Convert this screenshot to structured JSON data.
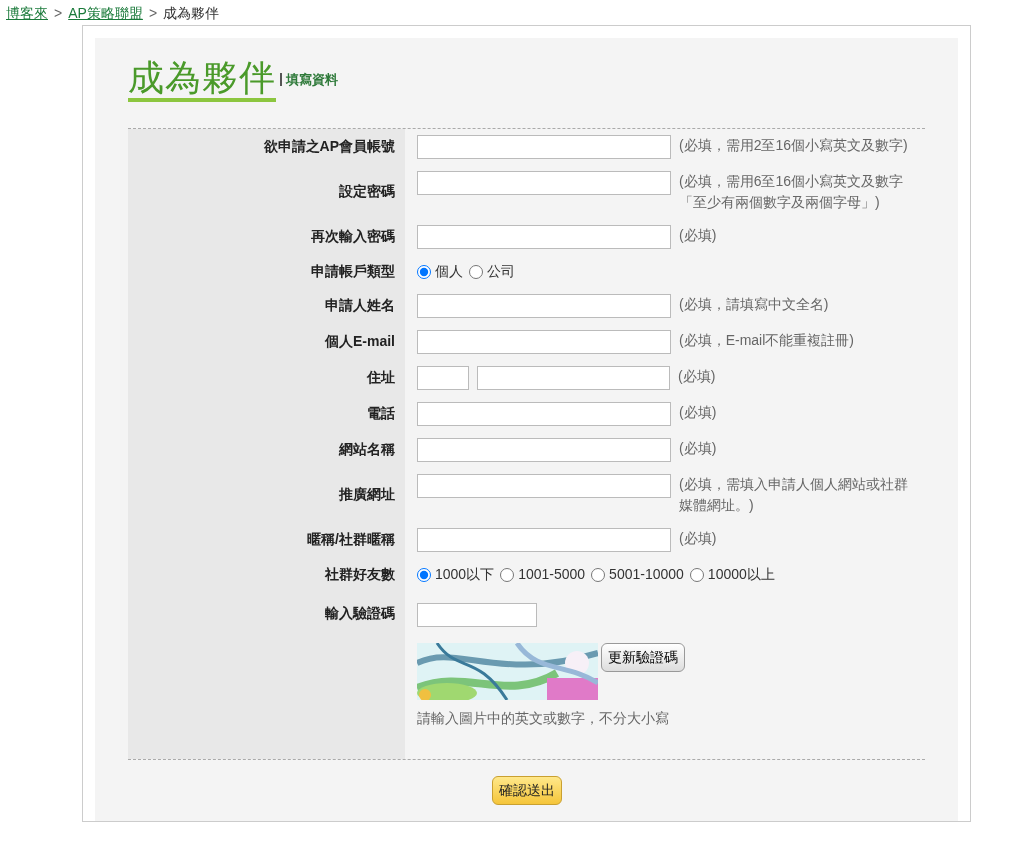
{
  "breadcrumb": [
    {
      "label": "博客來",
      "link": true
    },
    {
      "label": "AP策略聯盟",
      "link": true
    },
    {
      "label": "成為夥伴",
      "link": false
    }
  ],
  "breadcrumb_separator": ">",
  "heading": {
    "title": "成為夥伴",
    "subtitle": "填寫資料"
  },
  "form_rows": [
    {
      "kind": "text",
      "label": "欲申請之AP會員帳號",
      "hint": "(必填，需用2至16個小寫英文及數字)"
    },
    {
      "kind": "text",
      "label": "設定密碼",
      "hint": "(必填，需用6至16個小寫英文及數字「至少有兩個數字及兩個字母」)"
    },
    {
      "kind": "text",
      "label": "再次輸入密碼",
      "hint": "(必填)"
    },
    {
      "kind": "radio",
      "label": "申請帳戶類型",
      "options": [
        {
          "label": "個人",
          "selected": true
        },
        {
          "label": "公司",
          "selected": false
        }
      ]
    },
    {
      "kind": "text",
      "label": "申請人姓名",
      "hint": "(必填，請填寫中文全名)"
    },
    {
      "kind": "text",
      "label": "個人E-mail",
      "hint": "(必填，E-mail不能重複註冊)"
    },
    {
      "kind": "address",
      "label": "住址",
      "hint": "(必填)"
    },
    {
      "kind": "text",
      "label": "電話",
      "hint": "(必填)"
    },
    {
      "kind": "text",
      "label": "網站名稱",
      "hint": "(必填)"
    },
    {
      "kind": "text",
      "label": "推廣網址",
      "hint": "(必填，需填入申請人個人網站或社群媒體網址。)"
    },
    {
      "kind": "text",
      "label": "暱稱/社群暱稱",
      "hint": "(必填)"
    },
    {
      "kind": "radio",
      "label": "社群好友數",
      "options": [
        {
          "label": "1000以下",
          "selected": true
        },
        {
          "label": "1001-5000",
          "selected": false
        },
        {
          "label": "5001-10000",
          "selected": false
        },
        {
          "label": "10000以上",
          "selected": false
        }
      ]
    },
    {
      "kind": "captcha",
      "label": "輸入驗證碼",
      "refresh_button": "更新驗證碼",
      "hint": "請輸入圖片中的英文或數字，不分大小寫"
    }
  ],
  "submit_button": "確認送出"
}
